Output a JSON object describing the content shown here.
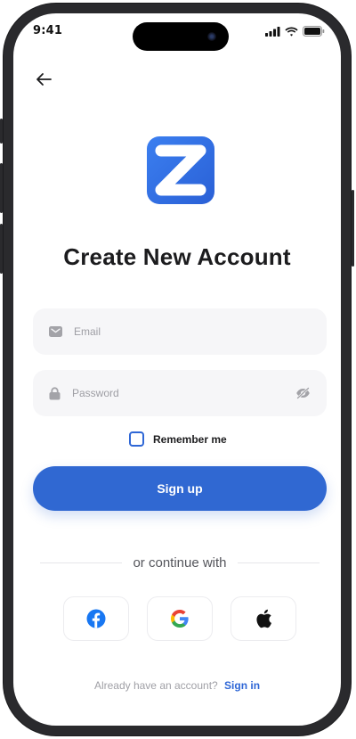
{
  "status_bar": {
    "time": "9:41"
  },
  "header": {
    "back_icon": "arrow-left-icon"
  },
  "brand": {
    "logo_icon": "z-logo-icon",
    "color": "#2f6fe0"
  },
  "page": {
    "title": "Create New Account"
  },
  "form": {
    "email": {
      "placeholder": "Email",
      "value": "",
      "icon": "mail-icon"
    },
    "password": {
      "placeholder": "Password",
      "value": "",
      "icon": "lock-icon",
      "toggle_icon": "eye-off-icon"
    },
    "remember": {
      "label": "Remember me",
      "checked": false
    },
    "submit_label": "Sign up"
  },
  "social": {
    "divider_text": "or continue with",
    "providers": [
      {
        "name": "facebook",
        "icon": "facebook-icon"
      },
      {
        "name": "google",
        "icon": "google-icon"
      },
      {
        "name": "apple",
        "icon": "apple-icon"
      }
    ]
  },
  "footer": {
    "prompt": "Already have an account?",
    "link_label": "Sign in"
  },
  "colors": {
    "primary": "#3068d2",
    "field_bg": "#f6f6f8",
    "title": "#1c1c1e",
    "muted": "#a0a0a6"
  }
}
